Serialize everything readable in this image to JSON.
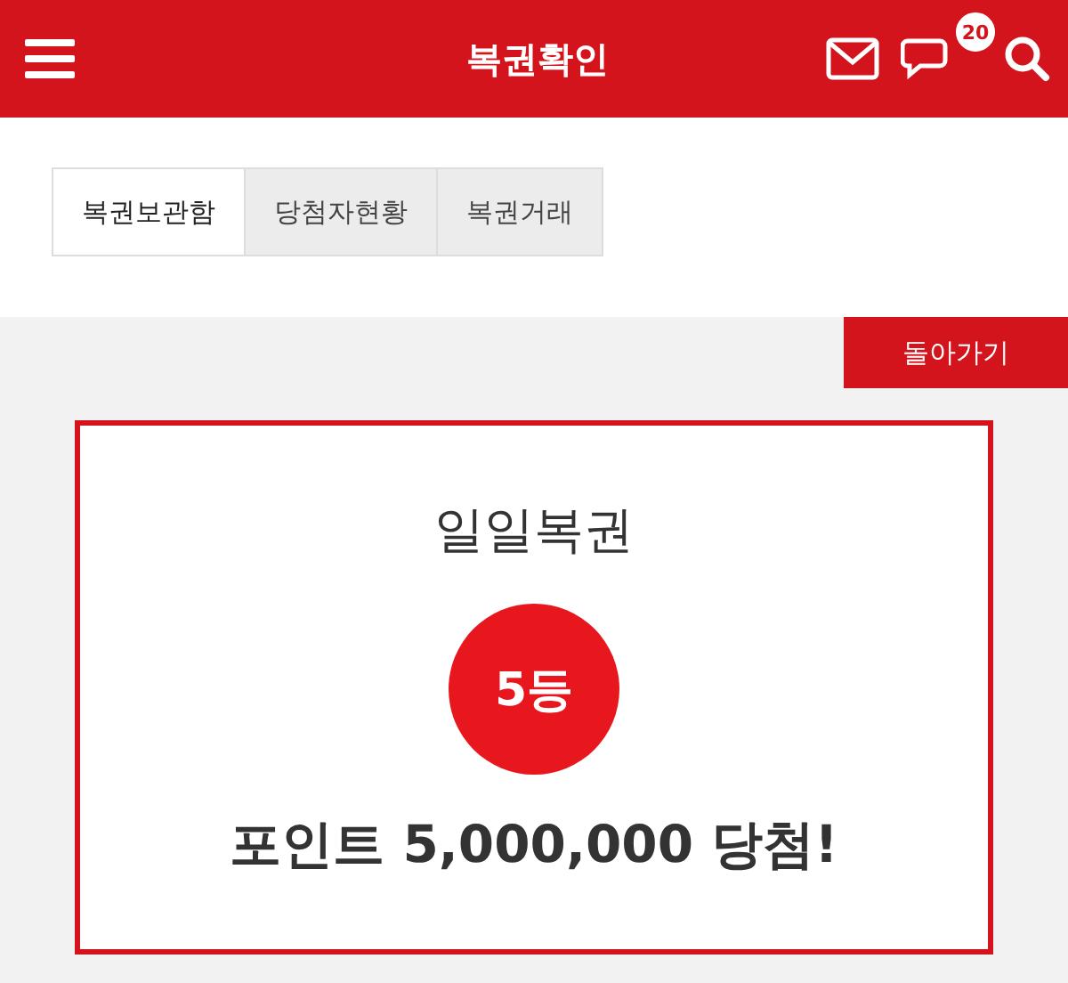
{
  "header": {
    "title": "복권확인",
    "badge": "20"
  },
  "tabs": [
    {
      "label": "복권보관함",
      "selected": true
    },
    {
      "label": "당첨자현황",
      "selected": false
    },
    {
      "label": "복권거래",
      "selected": false
    }
  ],
  "back_button": "돌아가기",
  "result": {
    "title": "일일복권",
    "rank": "5등",
    "message": "포인트 5,000,000 당첨!"
  }
}
